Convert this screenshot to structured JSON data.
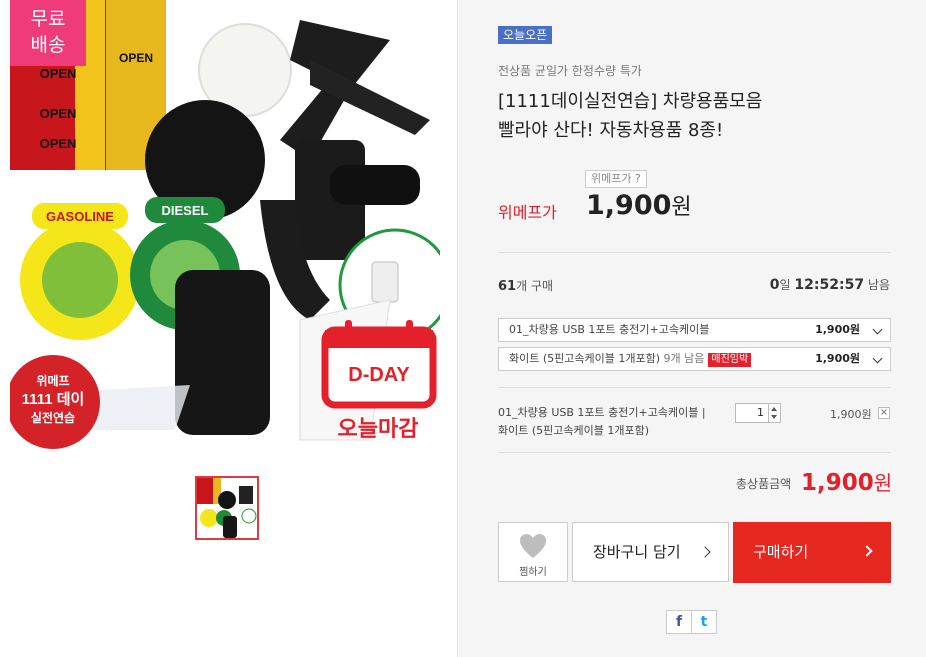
{
  "badge": {
    "line1": "무료",
    "line2": "배송"
  },
  "images": {
    "sign_texts": [
      "OPEN",
      "OPEN",
      "OPEN",
      "OPEN"
    ],
    "promo": {
      "line1": "위메프",
      "line2": "1111 데이",
      "line3": "실전연습"
    },
    "dday": {
      "label": "D-DAY",
      "sub": "오늘마감"
    },
    "gas_labels": {
      "gasoline": "GASOLINE",
      "diesel": "DIESEL"
    }
  },
  "product": {
    "tag": "오늘오픈",
    "sub": "전상품 균일가 한정수량 특가",
    "title_line1": "[1111데이실전연습] 차량용품모음",
    "title_line2": "빨라야 산다! 자동차용품 8종!",
    "price_question": "위메프가 ?",
    "price_label": "위메프가",
    "price": "1,900",
    "price_unit": "원"
  },
  "status": {
    "buy_count": "61",
    "buy_suffix": "개 구매",
    "timer_day": "0",
    "timer_day_suffix": "일",
    "timer_time": "12:52:57",
    "timer_suffix": "남음"
  },
  "options": [
    {
      "label": "01_차량용 USB 1포트 충전기+고속케이블",
      "price": "1,900원"
    },
    {
      "label": "화이트 (5핀고속케이블 1개포함)",
      "remain": "9개 남음",
      "badge": "매진임박",
      "price": "1,900원"
    }
  ],
  "selected": {
    "name": "01_차량용 USB 1포트 충전기+고속케이블 | 화이트 (5핀고속케이블 1개포함)",
    "qty": "1",
    "price": "1,900원",
    "remove": "×"
  },
  "total": {
    "label": "총상품금액",
    "price": "1,900",
    "unit": "원"
  },
  "actions": {
    "wish": "찜하기",
    "cart": "장바구니 담기",
    "buy": "구매하기"
  },
  "share": {
    "facebook": "f",
    "twitter": "t"
  },
  "colors": {
    "accent": "#e5271f",
    "tag": "#4a6fc6",
    "badge": "#f03b7b"
  }
}
